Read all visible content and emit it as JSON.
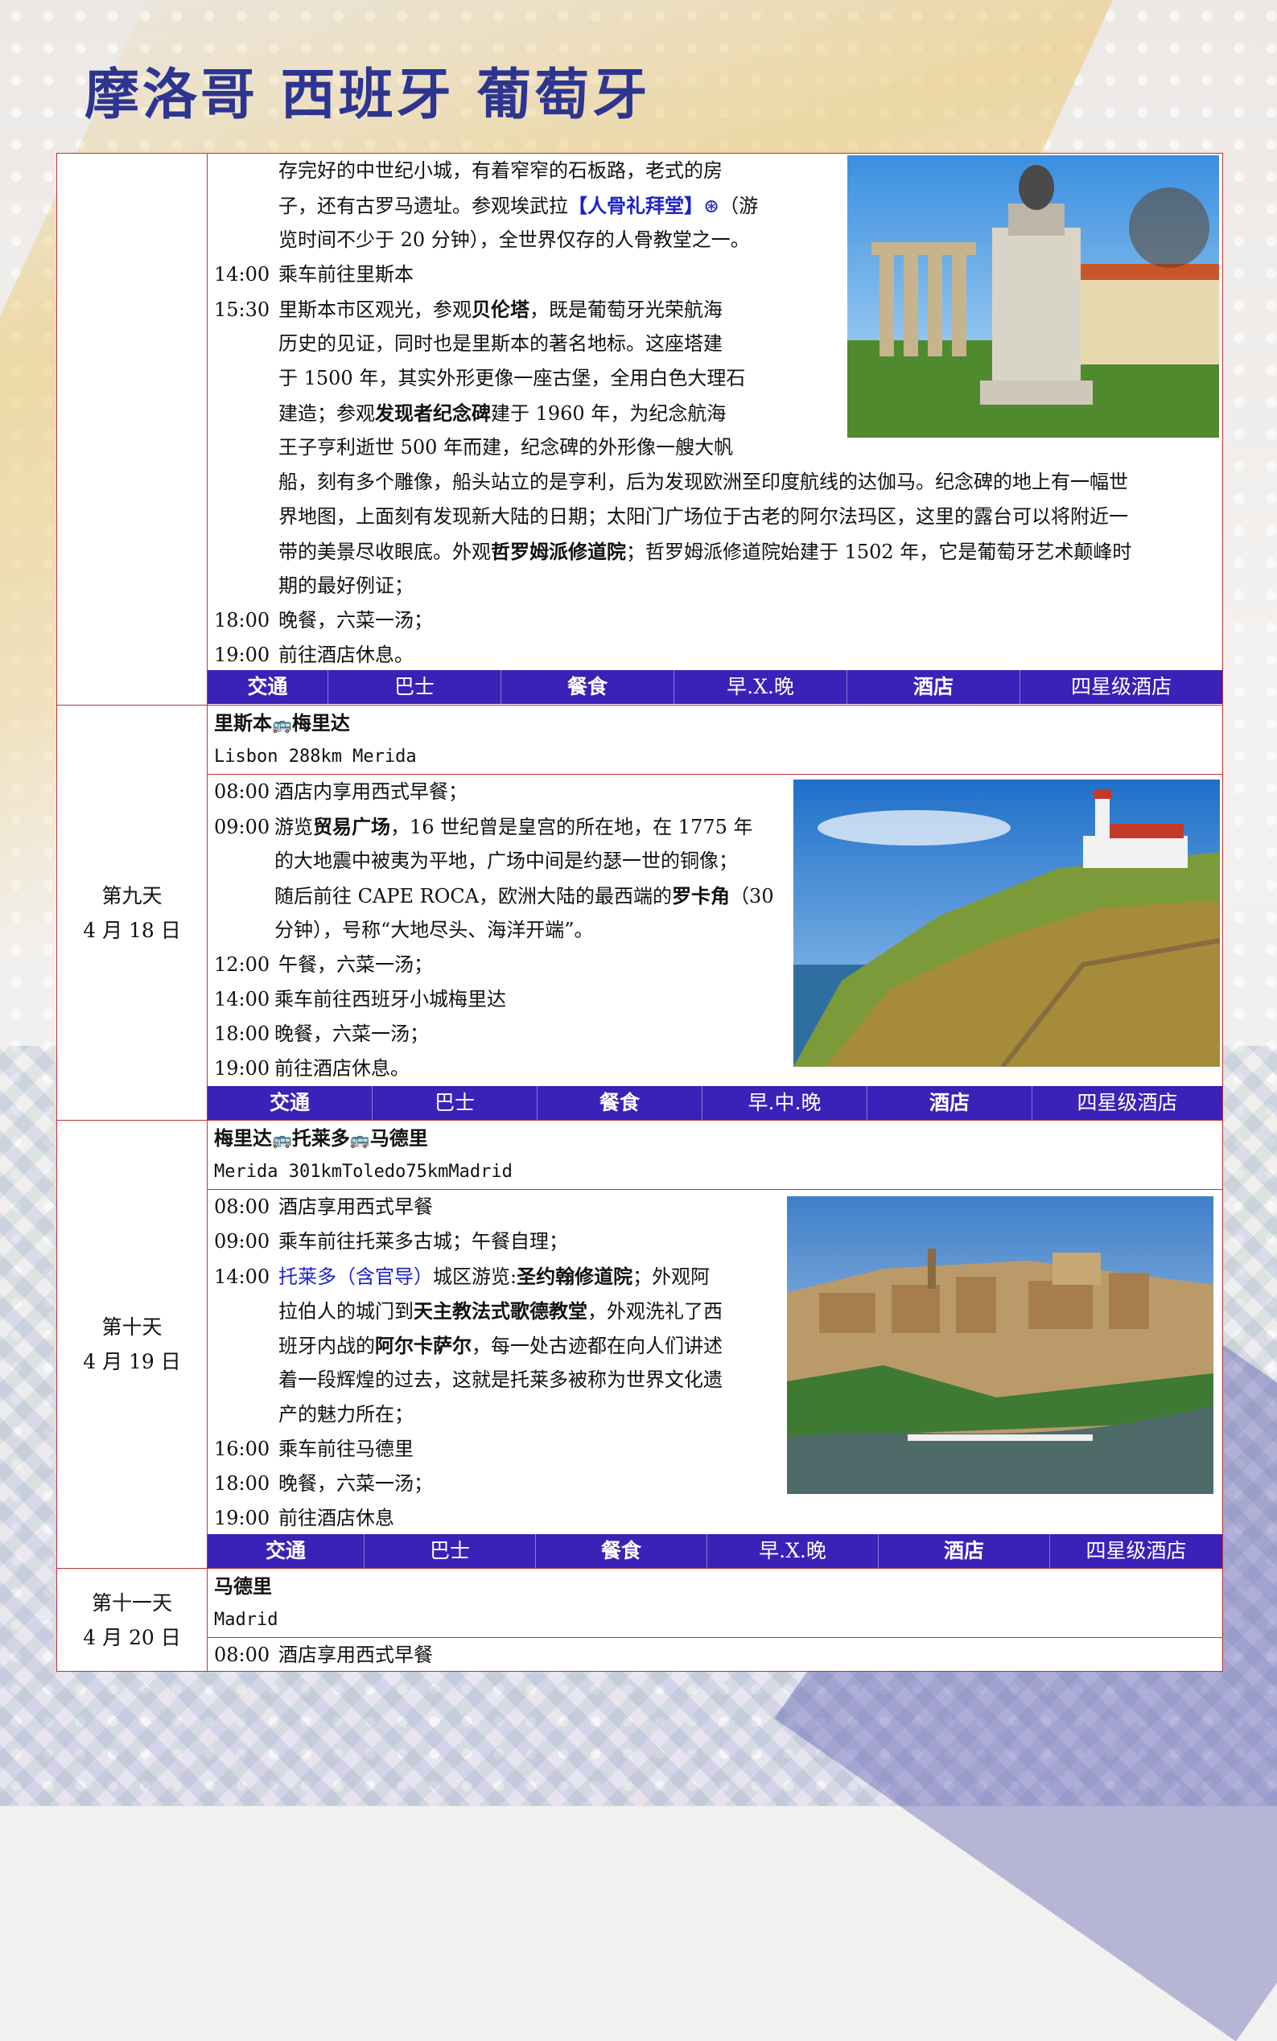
{
  "page_title": "摩洛哥 西班牙 葡萄牙",
  "day8_cont": {
    "lines": [
      "存完好的中世纪小城，有着窄窄的石板路，老式的房",
      "子，还有古罗马遗址。参观埃武拉",
      "【人骨礼拜堂】",
      "（游",
      "览时间不少于 20 分钟），全世界仅存的人骨教堂之一。"
    ],
    "items": [
      {
        "time": "14:00",
        "text": "乘车前往里斯本"
      },
      {
        "time": "15:30",
        "text_a": "里斯本市区观光，参观",
        "bold_a": "贝伦塔",
        "text_b": "，既是葡萄牙光荣航海"
      }
    ],
    "cont_lines": [
      "历史的见证，同时也是里斯本的著名地标。这座塔建",
      "于 1500 年，其实外形更像一座古堡，全用白色大理石",
      "王子亨利逝世 500 年而建，纪念碑的外形像一艘大帆",
      "船，刻有多个雕像，船头站立的是亨利，后为发现欧洲至印度航线的达伽马。纪念碑的地上有一幅世",
      "界地图，上面刻有发现新大陆的日期；太阳门广场位于古老的阿尔法玛区，这里的露台可以将附近一",
      "带的美景尽收眼底。外观",
      "；哲罗姆派修道院始建于 1502 年，它是葡萄牙艺术颠峰时",
      "期的最好例证；"
    ],
    "build_a": "建造；参观",
    "build_bold": "发现者纪念碑",
    "build_b": "建于 1960 年，为纪念航海",
    "jeronimos": "哲罗姆派修道院",
    "dinner": {
      "time": "18:00",
      "text": "晚餐，六菜一汤；"
    },
    "hotel": {
      "time": "19:00",
      "text": "前往酒店休息。"
    },
    "footer": [
      "交通",
      "巴士",
      "餐食",
      "早.X.晚",
      "酒店",
      "四星级酒店"
    ]
  },
  "day9": {
    "day": "第九天",
    "date": "4 月 18 日",
    "route_cn_a": "里斯本",
    "route_cn_b": "梅里达",
    "route_en": "Lisbon 288km Merida",
    "l1": {
      "time": "08:00",
      "text": "酒店内享用西式早餐；"
    },
    "l2": {
      "time": "09:00",
      "a": "游览",
      "b": "贸易广场",
      "c": "，16 世纪曾是皇宫的所在地，在 1775 年"
    },
    "l2c": "的大地震中被夷为平地，广场中间是约瑟一世的铜像；",
    "l2d_a": "随后前往 CAPE ROCA，欧洲大陆的最西端的",
    "l2d_b": "罗卡角",
    "l2d_c": "（30",
    "l2e": "分钟），号称“大地尽头、海洋开端”。",
    "l3": {
      "time": "12:00",
      "text": "午餐，六菜一汤；"
    },
    "l4": {
      "time": "14:00",
      "text": "乘车前往西班牙小城梅里达"
    },
    "l5": {
      "time": "18:00",
      "text": "晚餐，六菜一汤；"
    },
    "l6": {
      "time": "19:00",
      "text": "前往酒店休息。"
    },
    "footer": [
      "交通",
      "巴士",
      "餐食",
      "早.中.晚",
      "酒店",
      "四星级酒店"
    ]
  },
  "day10": {
    "day": "第十天",
    "date": "4 月 19 日",
    "route_cn_a": "梅里达",
    "route_cn_b": "托莱多",
    "route_cn_c": "马德里",
    "route_en": "Merida 301kmToledo75kmMadrid",
    "l1": {
      "time": "08:00",
      "text": "酒店享用西式早餐"
    },
    "l2": {
      "time": "09:00",
      "text": "乘车前往托莱多古城；午餐自理；"
    },
    "l3": {
      "time": "14:00",
      "hl": "托莱多（含官导）",
      "a": "城区游览:",
      "b": "圣约翰修道院",
      "c": "；外观阿"
    },
    "l3b_a": "拉伯人的城门到",
    "l3b_b": "天主教法式歌德教堂",
    "l3b_c": "，外观洗礼了西",
    "l3c_a": "班牙内战的",
    "l3c_b": "阿尔卡萨尔",
    "l3c_c": "，每一处古迹都在向人们讲述",
    "l3d": "着一段辉煌的过去，这就是托莱多被称为世界文化遗",
    "l3e": "产的魅力所在；",
    "l4": {
      "time": "16:00",
      "text": "乘车前往马德里"
    },
    "l5": {
      "time": "18:00",
      "text": "晚餐，六菜一汤；"
    },
    "l6": {
      "time": "19:00",
      "text": "前往酒店休息"
    },
    "footer": [
      "交通",
      "巴士",
      "餐食",
      "早.X.晚",
      "酒店",
      "四星级酒店"
    ]
  },
  "day11": {
    "day": "第十一天",
    "date": "4 月 20 日",
    "route_cn": "马德里",
    "route_en": "Madrid",
    "l1": {
      "time": "08:00",
      "text": "酒店享用西式早餐"
    }
  },
  "icons": {
    "bus": "bus-icon",
    "wheel": "wheel-icon"
  },
  "colors": {
    "title": "#2d3590",
    "border": "#c0303a",
    "footer_bg": "#3a21b7",
    "highlight": "#1c22c8"
  }
}
